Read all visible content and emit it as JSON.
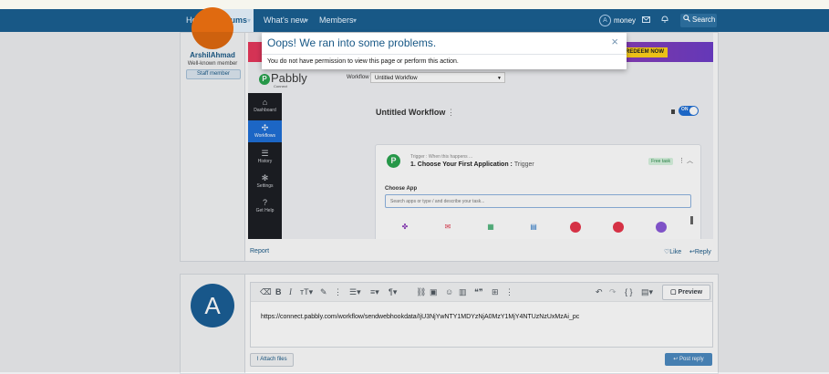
{
  "nav": {
    "home": "Home",
    "forums": "Forums",
    "whats_new": "What's new",
    "members": "Members",
    "arrow": "▾",
    "user": "money",
    "user_initial": "A",
    "search": "Search"
  },
  "post": {
    "username": "ArshilAhmad",
    "user_title": "Well-known member",
    "badge": "Staff member",
    "report": "Report",
    "like": "Like",
    "reply": "Reply"
  },
  "pabbly": {
    "redeem": "REDEEM NOW",
    "logo": "Pabbly",
    "logo_sub": "Connect",
    "workflow_label": "Workflow",
    "workflow_value": "Untitled Workflow",
    "sidebar": [
      {
        "label": "Dashboard",
        "icon": "home-icon"
      },
      {
        "label": "Workflows",
        "icon": "workflow-icon"
      },
      {
        "label": "History",
        "icon": "history-icon"
      },
      {
        "label": "Settings",
        "icon": "gear-icon"
      },
      {
        "label": "Get Help",
        "icon": "help-icon"
      }
    ],
    "title": "Untitled Workflow",
    "toggle": "ON",
    "trigger_small": "Trigger : When this happens ...",
    "trigger_main": "1. Choose Your First Application :",
    "trigger_suffix": "Trigger",
    "free_task": "Free task",
    "choose_app": "Choose App",
    "search_placeholder": "Search apps or type / and describe your task..."
  },
  "reply": {
    "avatar_letter": "A",
    "preview": "Preview",
    "editor_text": "https://connect.pabbly.com/workflow/sendwebhookdata/IjU3NjYwNTY1MDYzNjA0MzY1MjY4NTUzNzUxMzAi_pc",
    "attach": "Attach files",
    "post_reply": "Post reply"
  },
  "modal": {
    "title": "Oops! We ran into some problems.",
    "close": "×",
    "message": "You do not have permission to view this page or perform this action."
  },
  "colors": {
    "nav_bg": "#185886",
    "link": "#185886",
    "pabbly_green": "#2aa44f",
    "pabbly_blue": "#1f6fd6"
  }
}
